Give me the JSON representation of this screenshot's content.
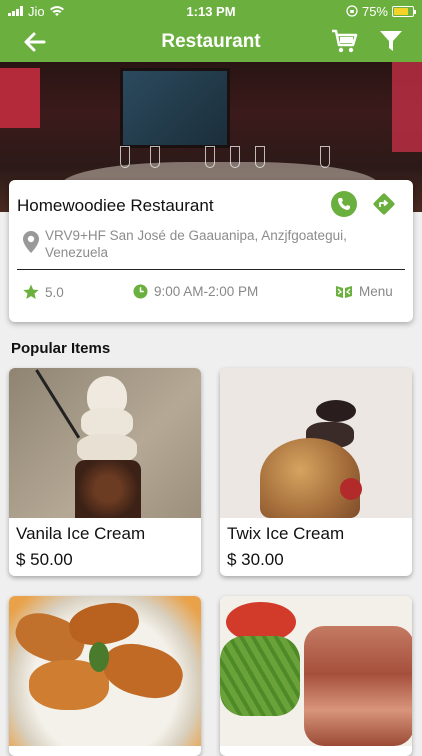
{
  "status_bar": {
    "carrier": "Jio",
    "time": "1:13 PM",
    "battery": "75%"
  },
  "app_bar": {
    "title": "Restaurant",
    "back_icon": "arrow-left-icon",
    "cart_icon": "cart-icon",
    "filter_icon": "filter-icon"
  },
  "restaurant": {
    "name": "Homewoodiee Restaurant",
    "address": "VRV9+HF San José de Gaauanipa, Anzjfgoategui, Venezuela",
    "rating": "5.0",
    "hours": "9:00 AM-2:00 PM",
    "menu_label": "Menu"
  },
  "popular": {
    "heading": "Popular Items",
    "items": [
      {
        "name": "Vanila Ice Cream",
        "price": "$ 50.00"
      },
      {
        "name": "Twix Ice Cream",
        "price": "$ 30.00"
      },
      {
        "name": "",
        "price": ""
      },
      {
        "name": "",
        "price": ""
      }
    ]
  },
  "colors": {
    "accent": "#6bb03f",
    "battery": "#f3d327"
  }
}
